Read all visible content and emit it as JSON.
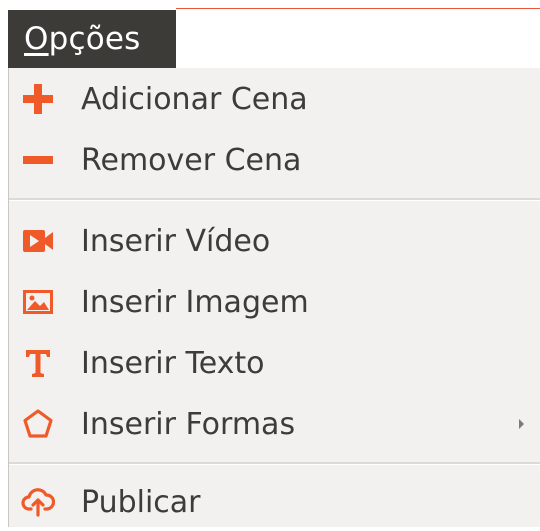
{
  "menu": {
    "title_mnemonic": "O",
    "title_rest": "pções",
    "items": [
      {
        "label": "Adicionar Cena",
        "icon": "plus-icon"
      },
      {
        "label": "Remover Cena",
        "icon": "minus-icon"
      },
      {
        "label": "Inserir Vídeo",
        "icon": "video-icon"
      },
      {
        "label": "Inserir Imagem",
        "icon": "image-icon"
      },
      {
        "label": "Inserir Texto",
        "icon": "text-icon"
      },
      {
        "label": "Inserir Formas",
        "icon": "pentagon-icon",
        "has_submenu": true
      },
      {
        "label": "Publicar",
        "icon": "cloud-upload-icon"
      }
    ]
  },
  "colors": {
    "accent": "#f05a28",
    "menubar_bg": "#3c3b37",
    "dropdown_bg": "#f2f1f0",
    "text": "#3c3c3c"
  }
}
